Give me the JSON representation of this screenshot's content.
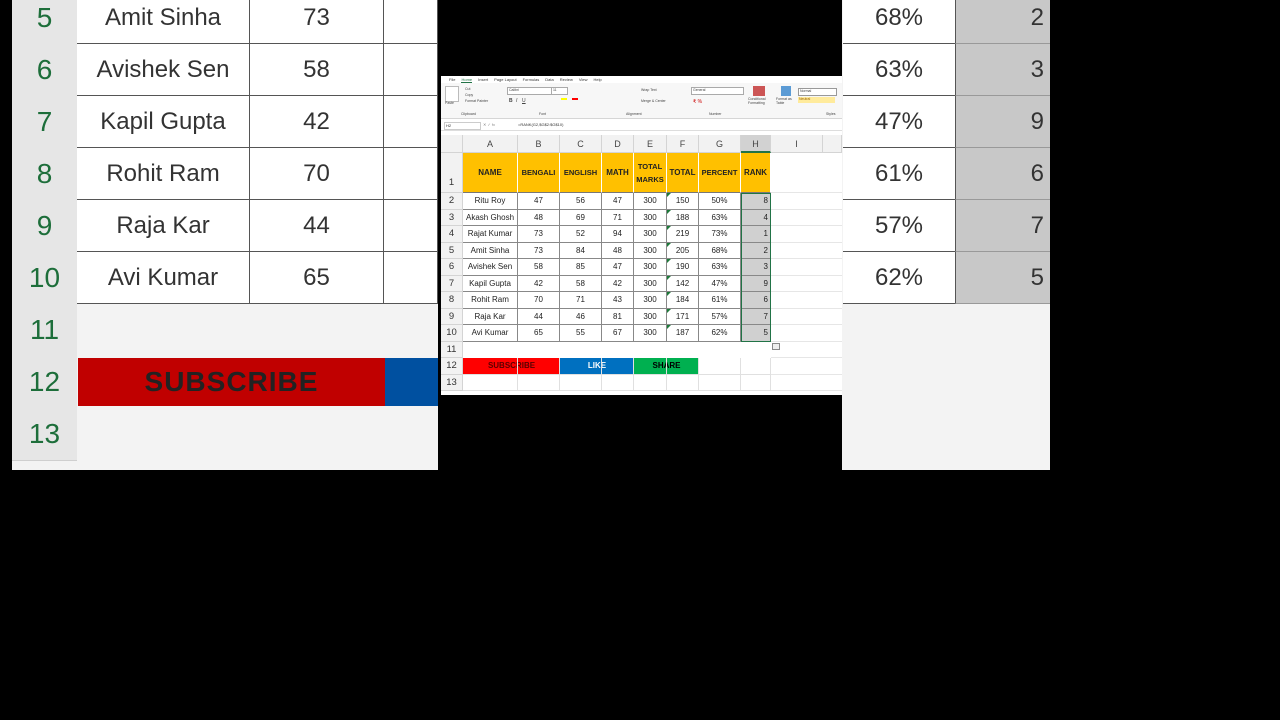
{
  "background": {
    "rows": [
      {
        "num": "5",
        "name": "Amit Sinha",
        "b": "73",
        "pct": "68%",
        "rank": "2"
      },
      {
        "num": "6",
        "name": "Avishek Sen",
        "b": "58",
        "pct": "63%",
        "rank": "3"
      },
      {
        "num": "7",
        "name": "Kapil Gupta",
        "b": "42",
        "pct": "47%",
        "rank": "9"
      },
      {
        "num": "8",
        "name": "Rohit Ram",
        "b": "70",
        "pct": "61%",
        "rank": "6"
      },
      {
        "num": "9",
        "name": "Raja Kar",
        "b": "44",
        "pct": "57%",
        "rank": "7"
      },
      {
        "num": "10",
        "name": "Avi Kumar",
        "b": "65",
        "pct": "62%",
        "rank": "5"
      }
    ],
    "empty_rows": [
      "11",
      "12",
      "13"
    ],
    "subscribe": "SUBSCRIBE"
  },
  "ribbon": {
    "tabs": [
      "File",
      "Home",
      "Insert",
      "Page Layout",
      "Formulas",
      "Data",
      "Review",
      "View",
      "Help"
    ],
    "active_tab": "Home",
    "font_name": "Calibri",
    "font_size": "11",
    "wrap_text": "Wrap Text",
    "merge_center": "Merge & Center",
    "number_format": "General",
    "cut": "Cut",
    "copy": "Copy",
    "format_painter": "Format Painter",
    "paste": "Paste",
    "cond_format": "Conditional Formatting",
    "format_table": "Format as Table",
    "style_normal": "Normal",
    "style_neutral": "Neutral",
    "groups": [
      "Clipboard",
      "Font",
      "Alignment",
      "Number",
      "Styles"
    ]
  },
  "formula_bar": {
    "name_box": "H2",
    "formula": "=RANK(G2,$G$2:$G$10)"
  },
  "columns": [
    "A",
    "B",
    "C",
    "D",
    "E",
    "F",
    "G",
    "H",
    "I"
  ],
  "headers": [
    "NAME",
    "BENGALI",
    "ENGLISH",
    "MATH",
    "TOTAL MARKS",
    "TOTAL",
    "PERCENT",
    "RANK"
  ],
  "row_numbers": [
    "1",
    "2",
    "3",
    "4",
    "5",
    "6",
    "7",
    "8",
    "9",
    "10",
    "11",
    "12",
    "13"
  ],
  "students": [
    [
      "Ritu Roy",
      "47",
      "56",
      "47",
      "300",
      "150",
      "50%",
      "8"
    ],
    [
      "Akash Ghosh",
      "48",
      "69",
      "71",
      "300",
      "188",
      "63%",
      "4"
    ],
    [
      "Rajat Kumar",
      "73",
      "52",
      "94",
      "300",
      "219",
      "73%",
      "1"
    ],
    [
      "Amit Sinha",
      "73",
      "84",
      "48",
      "300",
      "205",
      "68%",
      "2"
    ],
    [
      "Avishek Sen",
      "58",
      "85",
      "47",
      "300",
      "190",
      "63%",
      "3"
    ],
    [
      "Kapil Gupta",
      "42",
      "58",
      "42",
      "300",
      "142",
      "47%",
      "9"
    ],
    [
      "Rohit Ram",
      "70",
      "71",
      "43",
      "300",
      "184",
      "61%",
      "6"
    ],
    [
      "Raja Kar",
      "44",
      "46",
      "81",
      "300",
      "171",
      "57%",
      "7"
    ],
    [
      "Avi Kumar",
      "65",
      "55",
      "67",
      "300",
      "187",
      "62%",
      "5"
    ]
  ],
  "buttons": {
    "subscribe": "SUBSCRIBE",
    "like": "LIKE",
    "share": "SHARE"
  },
  "colors": {
    "header": "#ffc000",
    "subscribe": "#ff0000",
    "like": "#0070c0",
    "share": "#00b050",
    "rank_fill": "#d0d0d0"
  }
}
